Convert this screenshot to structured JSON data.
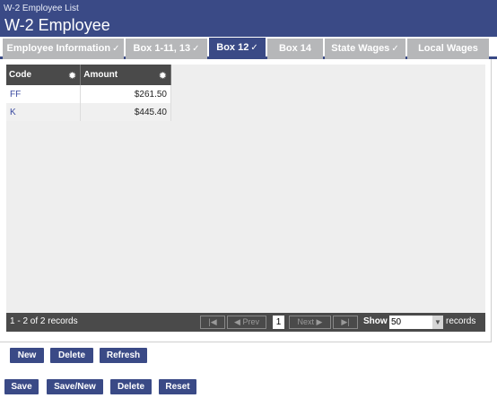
{
  "header": {
    "breadcrumb": "W-2 Employee List",
    "title": "W-2 Employee"
  },
  "tabs": [
    {
      "label": "Employee Information",
      "checked": true,
      "active": false
    },
    {
      "label": "Box 1-11, 13",
      "checked": true,
      "active": false
    },
    {
      "label": "Box 12",
      "checked": true,
      "active": true
    },
    {
      "label": "Box 14",
      "checked": false,
      "active": false
    },
    {
      "label": "State Wages",
      "checked": true,
      "active": false
    },
    {
      "label": "Local Wages",
      "checked": false,
      "active": false
    }
  ],
  "grid": {
    "columns": [
      "Code",
      "Amount"
    ],
    "rows": [
      {
        "code": "FF",
        "amount": "$261.50"
      },
      {
        "code": "K",
        "amount": "$445.40"
      }
    ]
  },
  "pager": {
    "info": "1 - 2 of 2 records",
    "prev_label": "Prev",
    "next_label": "Next",
    "page": "1",
    "show_label": "Show",
    "page_size": "50",
    "records_label": "records"
  },
  "grid_buttons": {
    "new": "New",
    "delete": "Delete",
    "refresh": "Refresh"
  },
  "form_buttons": {
    "save": "Save",
    "save_new": "Save/New",
    "delete": "Delete",
    "reset": "Reset"
  },
  "colors": {
    "primary": "#3a4a86",
    "tab_inactive": "#b6b7b9",
    "grid_header": "#4a4a4a"
  }
}
